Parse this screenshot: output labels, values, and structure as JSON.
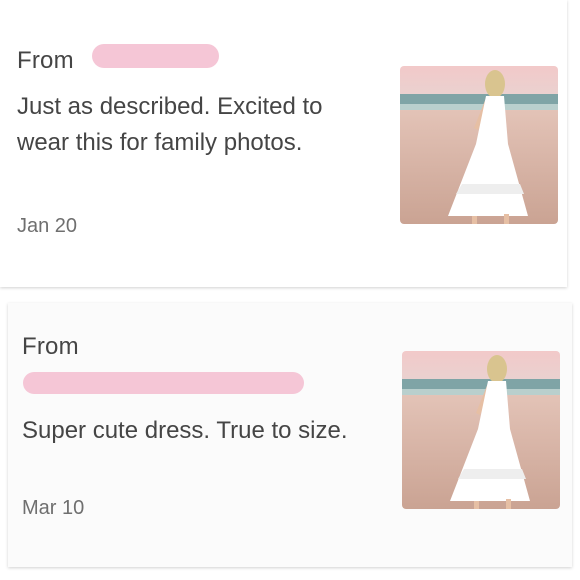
{
  "reviews": [
    {
      "from_label": "From",
      "text": "Just as described. Excited to wear this for family photos.",
      "date": "Jan 20"
    },
    {
      "from_label": "From",
      "text": "Super cute dress. True to size.",
      "date": "Mar 10"
    }
  ],
  "colors": {
    "redaction": "#f5c6d6",
    "text": "#454545",
    "date": "#6f6f6f"
  }
}
